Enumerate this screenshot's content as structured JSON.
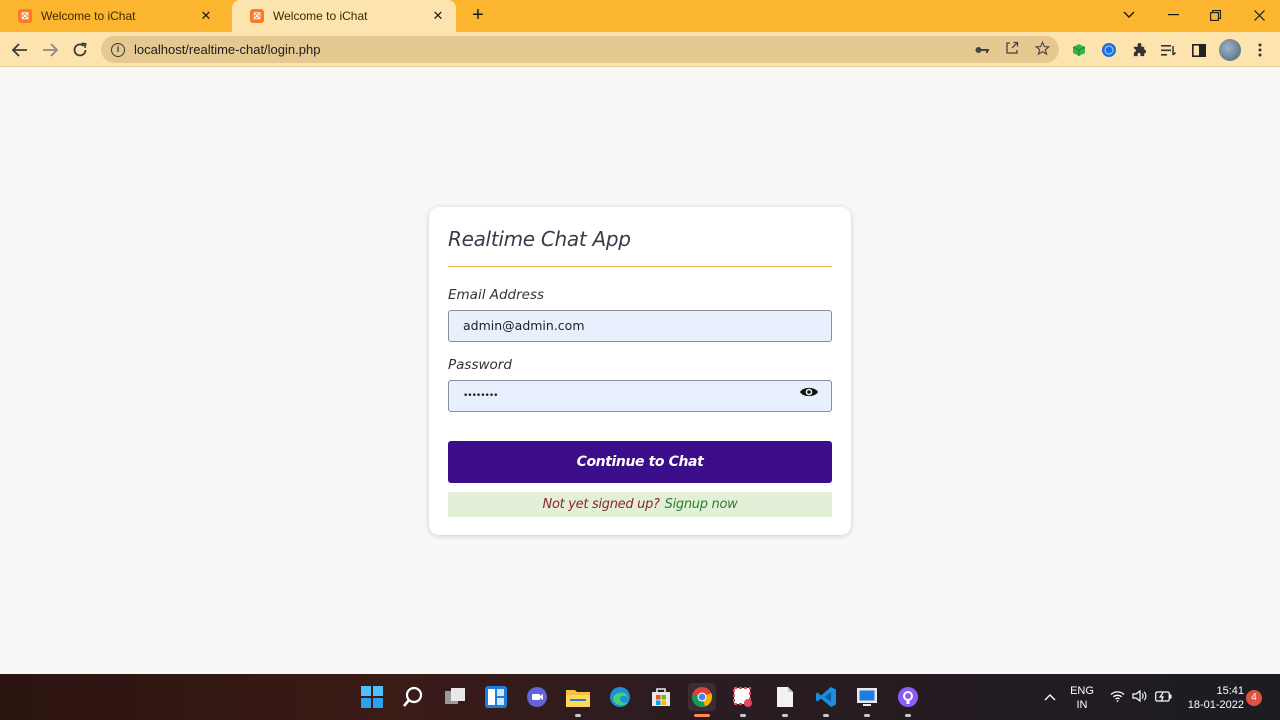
{
  "browser": {
    "tabs": [
      {
        "title": "Welcome to iChat",
        "favicon": "xampp-icon",
        "active": false
      },
      {
        "title": "Welcome to iChat",
        "favicon": "xampp-icon",
        "active": true
      }
    ],
    "url": "localhost/realtime-chat/login.php",
    "accent_color": "#fcb52f"
  },
  "login": {
    "title": "Realtime Chat App",
    "email_label": "Email Address",
    "email_value": "admin@admin.com",
    "password_label": "Password",
    "password_value": "••••••••",
    "submit_label": "Continue to Chat",
    "signup_question": "Not yet signed up?",
    "signup_link": "Signup now",
    "button_color": "#3c0d8a"
  },
  "taskbar": {
    "lang_top": "ENG",
    "lang_bottom": "IN",
    "time": "15:41",
    "date": "18-01-2022",
    "notifications": "4"
  }
}
